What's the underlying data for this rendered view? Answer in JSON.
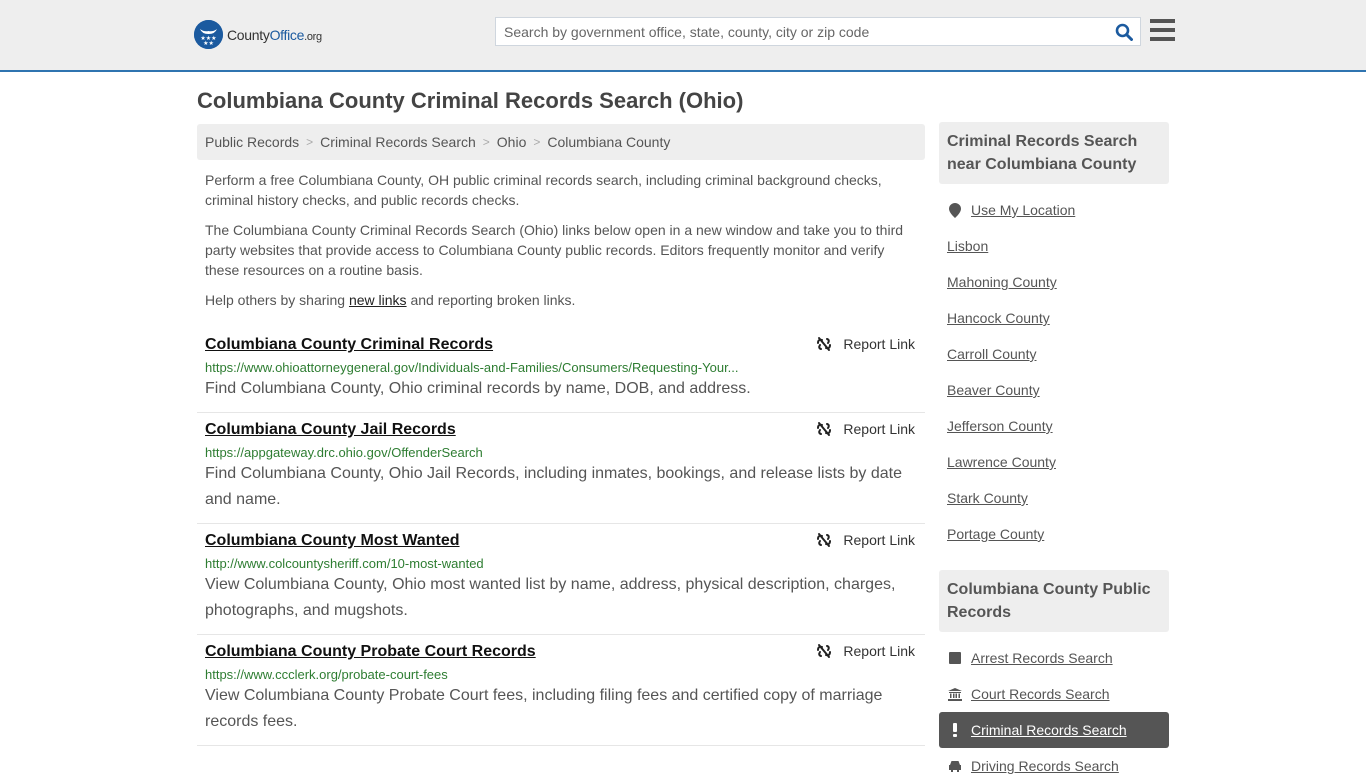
{
  "header": {
    "logo": {
      "brand_county": "County",
      "brand_office": "Office",
      "brand_tld": ".org"
    },
    "search": {
      "placeholder": "Search by government office, state, county, city or zip code",
      "value": ""
    },
    "icons": {
      "search": "search-icon",
      "menu": "hamburger-menu-icon"
    }
  },
  "page": {
    "title": "Columbiana County Criminal Records Search (Ohio)"
  },
  "breadcrumb": [
    "Public Records",
    "Criminal Records Search",
    "Ohio",
    "Columbiana County"
  ],
  "intro": {
    "p1": "Perform a free Columbiana County, OH public criminal records search, including criminal background checks, criminal history checks, and public records checks.",
    "p2": "The Columbiana County Criminal Records Search (Ohio) links below open in a new window and take you to third party websites that provide access to Columbiana County public records. Editors frequently monitor and verify these resources on a routine basis.",
    "p3_before": "Help others by sharing ",
    "p3_link": "new links",
    "p3_after": " and reporting broken links."
  },
  "results": [
    {
      "title": "Columbiana County Criminal Records",
      "url": "https://www.ohioattorneygeneral.gov/Individuals-and-Families/Consumers/Requesting-Your...",
      "desc": "Find Columbiana County, Ohio criminal records by name, DOB, and address.",
      "report": "Report Link"
    },
    {
      "title": "Columbiana County Jail Records",
      "url": "https://appgateway.drc.ohio.gov/OffenderSearch",
      "desc": "Find Columbiana County, Ohio Jail Records, including inmates, bookings, and release lists by date and name.",
      "report": "Report Link"
    },
    {
      "title": "Columbiana County Most Wanted",
      "url": "http://www.colcountysheriff.com/10-most-wanted",
      "desc": "View Columbiana County, Ohio most wanted list by name, address, physical description, charges, photographs, and mugshots.",
      "report": "Report Link"
    },
    {
      "title": "Columbiana County Probate Court Records",
      "url": "https://www.ccclerk.org/probate-court-fees",
      "desc": "View Columbiana County Probate Court fees, including filing fees and certified copy of marriage records fees.",
      "report": "Report Link"
    }
  ],
  "sidebar": {
    "nearby": {
      "title": "Criminal Records Search near Columbiana County",
      "use_location": "Use My Location",
      "items": [
        "Lisbon",
        "Mahoning County",
        "Hancock County",
        "Carroll County",
        "Beaver County",
        "Jefferson County",
        "Lawrence County",
        "Stark County",
        "Portage County"
      ]
    },
    "public_records": {
      "title": "Columbiana County Public Records",
      "items": [
        {
          "label": "Arrest Records Search",
          "icon": "square-icon",
          "active": false
        },
        {
          "label": "Court Records Search",
          "icon": "courthouse-icon",
          "active": false
        },
        {
          "label": "Criminal Records Search",
          "icon": "exclamation-icon",
          "active": true
        },
        {
          "label": "Driving Records Search",
          "icon": "car-icon",
          "active": false
        }
      ]
    }
  }
}
